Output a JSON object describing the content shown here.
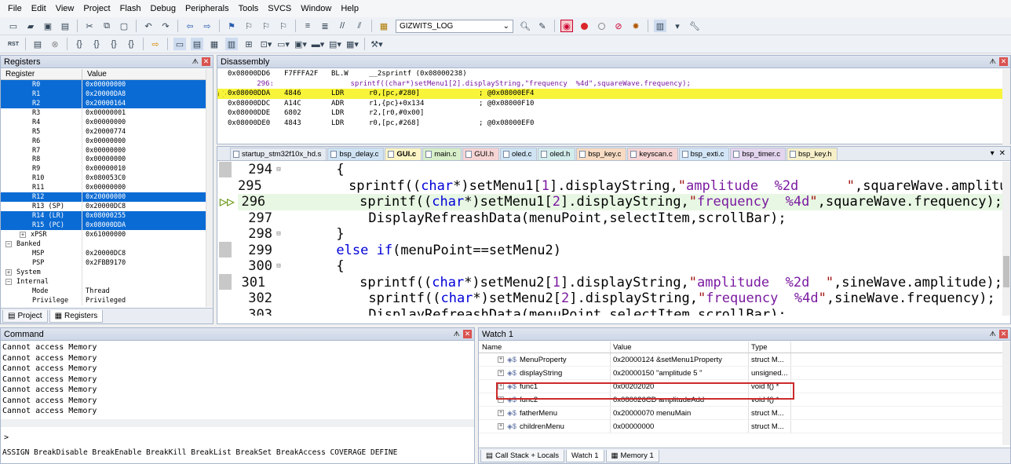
{
  "menu": [
    "File",
    "Edit",
    "View",
    "Project",
    "Flash",
    "Debug",
    "Peripherals",
    "Tools",
    "SVCS",
    "Window",
    "Help"
  ],
  "toolbar": {
    "target_combo": "GIZWITS_LOG",
    "rst_label": "RST"
  },
  "registers": {
    "title": "Registers",
    "col_register": "Register",
    "col_value": "Value",
    "rows": [
      {
        "name": "R0",
        "value": "0x00000000",
        "selected": true
      },
      {
        "name": "R1",
        "value": "0x20000DA8",
        "selected": true
      },
      {
        "name": "R2",
        "value": "0x20000164",
        "selected": true
      },
      {
        "name": "R3",
        "value": "0x00000001",
        "selected": false
      },
      {
        "name": "R4",
        "value": "0x00000000",
        "selected": false
      },
      {
        "name": "R5",
        "value": "0x20000774",
        "selected": false
      },
      {
        "name": "R6",
        "value": "0x00000000",
        "selected": false
      },
      {
        "name": "R7",
        "value": "0x00000000",
        "selected": false
      },
      {
        "name": "R8",
        "value": "0x00000000",
        "selected": false
      },
      {
        "name": "R9",
        "value": "0x00000010",
        "selected": false
      },
      {
        "name": "R10",
        "value": "0x080053C0",
        "selected": false
      },
      {
        "name": "R11",
        "value": "0x00000000",
        "selected": false
      },
      {
        "name": "R12",
        "value": "0x20000000",
        "selected": true
      },
      {
        "name": "R13 (SP)",
        "value": "0x20000DC8",
        "selected": false
      },
      {
        "name": "R14 (LR)",
        "value": "0x08000255",
        "selected": true
      },
      {
        "name": "R15 (PC)",
        "value": "0x08000DDA",
        "selected": true
      },
      {
        "name": "xPSR",
        "value": "0x61000000",
        "selected": false
      }
    ],
    "banked": {
      "label": "Banked",
      "rows": [
        {
          "name": "MSP",
          "value": "0x20000DC8"
        },
        {
          "name": "PSP",
          "value": "0x2FBB9170"
        }
      ]
    },
    "system": {
      "label": "System"
    },
    "internal": {
      "label": "Internal",
      "rows": [
        {
          "name": "Mode",
          "value": "Thread"
        },
        {
          "name": "Privilege",
          "value": "Privileged"
        }
      ]
    },
    "tabs": [
      "Project",
      "Registers"
    ]
  },
  "disassembly": {
    "title": "Disassembly",
    "lines": [
      {
        "addr": "0x08000DD6",
        "hex": "F7FFFA2F",
        "mnem": "BL.W",
        "ops": "__2sprintf (0x08000238)",
        "comment": "",
        "kind": "asm"
      },
      {
        "src": "   296:                  sprintf((char*)setMenu1[2].displayString,\"frequency  %4d\",squareWave.frequency);",
        "kind": "src"
      },
      {
        "addr": "0x08000DDA",
        "hex": "4846",
        "mnem": "LDR",
        "ops": "r0,[pc,#280]",
        "comment": "; @0x08000EF4",
        "kind": "cur"
      },
      {
        "addr": "0x08000DDC",
        "hex": "A14C",
        "mnem": "ADR",
        "ops": "r1,{pc}+0x134",
        "comment": "; @0x08000F10",
        "kind": "asm"
      },
      {
        "addr": "0x08000DDE",
        "hex": "6802",
        "mnem": "LDR",
        "ops": "r2,[r0,#0x00]",
        "comment": "",
        "kind": "asm"
      },
      {
        "addr": "0x08000DE0",
        "hex": "4843",
        "mnem": "LDR",
        "ops": "r0,[pc,#268]",
        "comment": "; @0x08000EF0",
        "kind": "asm"
      }
    ]
  },
  "editor": {
    "tabs": [
      {
        "label": "startup_stm32f10x_hd.s",
        "color": "#e6ebf2",
        "active": false
      },
      {
        "label": "bsp_delay.c",
        "color": "#cfe3f3",
        "active": false
      },
      {
        "label": "GUI.c",
        "color": "#fff5c4",
        "active": true
      },
      {
        "label": "main.c",
        "color": "#d7eec9",
        "active": false
      },
      {
        "label": "GUI.h",
        "color": "#f6d4d4",
        "active": false
      },
      {
        "label": "oled.c",
        "color": "#cfe3f3",
        "active": false
      },
      {
        "label": "oled.h",
        "color": "#d3ecec",
        "active": false
      },
      {
        "label": "bsp_key.c",
        "color": "#f7dcc3",
        "active": false
      },
      {
        "label": "keyscan.c",
        "color": "#f6d4d4",
        "active": false
      },
      {
        "label": "bsp_exti.c",
        "color": "#d3e6f7",
        "active": false
      },
      {
        "label": "bsp_timer.c",
        "color": "#e4d5ef",
        "active": false
      },
      {
        "label": "bsp_key.h",
        "color": "#f7efc9",
        "active": false
      }
    ],
    "lines": [
      {
        "num": "294",
        "fold": "⊟",
        "code": "      {",
        "hl": false
      },
      {
        "num": "295",
        "fold": "",
        "code": "          sprintf((char*)setMenu1[1].displayString,\"amplitude  %2d      \",squareWave.amplitu",
        "hl": false
      },
      {
        "num": "296",
        "fold": "",
        "code": "          sprintf((char*)setMenu1[2].displayString,\"frequency  %4d\",squareWave.frequency);",
        "hl": true
      },
      {
        "num": "297",
        "fold": "",
        "code": "          DisplayRefreashData(menuPoint,selectItem,scrollBar);",
        "hl": false
      },
      {
        "num": "298",
        "fold": "⊟",
        "code": "      }",
        "hl": false
      },
      {
        "num": "299",
        "fold": "",
        "code": "      else if(menuPoint==setMenu2)",
        "hl": false
      },
      {
        "num": "300",
        "fold": "⊟",
        "code": "      {",
        "hl": false
      },
      {
        "num": "301",
        "fold": "",
        "code": "          sprintf((char*)setMenu2[1].displayString,\"amplitude  %2d  \",sineWave.amplitude);",
        "hl": false
      },
      {
        "num": "302",
        "fold": "",
        "code": "          sprintf((char*)setMenu2[2].displayString,\"frequency  %4d\",sineWave.frequency);",
        "hl": false
      },
      {
        "num": "303",
        "fold": "",
        "code": "          DisplayRefreashData(menuPoint,selectItem,scrollBar);",
        "hl": false
      }
    ]
  },
  "command": {
    "title": "Command",
    "output": [
      "Cannot access Memory",
      "Cannot access Memory",
      "Cannot access Memory",
      "Cannot access Memory",
      "Cannot access Memory",
      "Cannot access Memory",
      "Cannot access Memory"
    ],
    "prompt": ">",
    "help": "ASSIGN BreakDisable BreakEnable BreakKill BreakList BreakSet BreakAccess COVERAGE DEFINE"
  },
  "watch": {
    "title": "Watch 1",
    "col_name": "Name",
    "col_value": "Value",
    "col_type": "Type",
    "rows": [
      {
        "name": "MenuProperty",
        "value": "0x20000124 &setMenu1Property",
        "type": "struct M..."
      },
      {
        "name": "displayString",
        "value": "0x20000150 \"amplitude  5  \"",
        "type": "unsigned..."
      },
      {
        "name": "func1",
        "value": "0x00202020",
        "type": "void f()  *"
      },
      {
        "name": "func2",
        "value": "0x080026CD amplitudeAdd",
        "type": "void f()  *"
      },
      {
        "name": "fatherMenu",
        "value": "0x20000070 menuMain",
        "type": "struct M..."
      },
      {
        "name": "childrenMenu",
        "value": "0x00000000",
        "type": "struct M..."
      }
    ],
    "tabs": [
      "Call Stack + Locals",
      "Watch 1",
      "Memory 1"
    ]
  },
  "colors": {
    "selection": "#0b6bd4",
    "current_line": "#f7f43a",
    "highlight_box": "#cc2a2a"
  }
}
